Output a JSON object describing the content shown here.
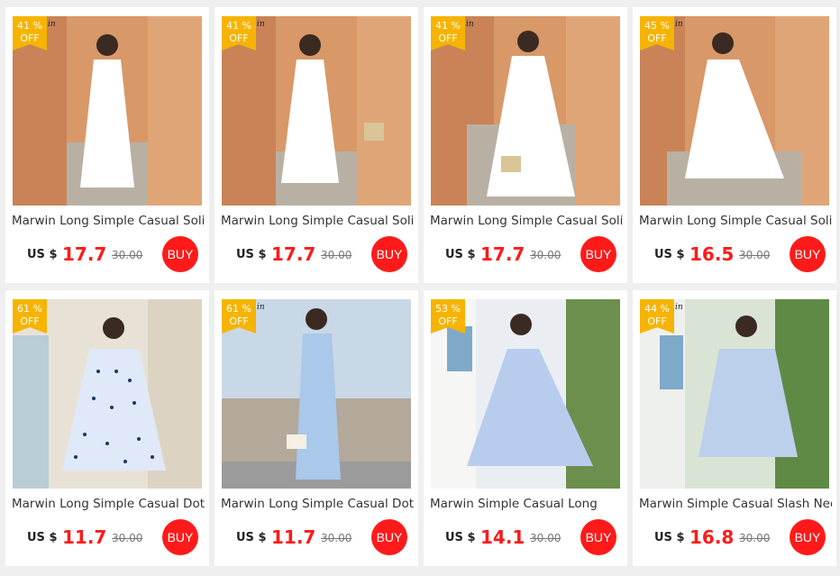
{
  "products": [
    {
      "discount": "41 %",
      "off": "OFF",
      "brand_fragment": "in",
      "title": "Marwin Long Simple Casual Solid",
      "currency": "US $",
      "price": "17.7",
      "old_price": "30.00",
      "buy": "BUY",
      "dress_color": "#ffffff",
      "bg_color": "#d89868"
    },
    {
      "discount": "41 %",
      "off": "OFF",
      "brand_fragment": "in",
      "title": "Marwin Long Simple Casual Solid",
      "currency": "US $",
      "price": "17.7",
      "old_price": "30.00",
      "buy": "BUY",
      "dress_color": "#ffffff",
      "bg_color": "#d89868"
    },
    {
      "discount": "41 %",
      "off": "OFF",
      "brand_fragment": "in",
      "title": "Marwin Long Simple Casual Solid",
      "currency": "US $",
      "price": "17.7",
      "old_price": "30.00",
      "buy": "BUY",
      "dress_color": "#ffffff",
      "bg_color": "#d89868"
    },
    {
      "discount": "45 %",
      "off": "OFF",
      "brand_fragment": "in",
      "title": "Marwin Long Simple Casual Solid",
      "currency": "US $",
      "price": "16.5",
      "old_price": "30.00",
      "buy": "BUY",
      "dress_color": "#ffffff",
      "bg_color": "#d89868"
    },
    {
      "discount": "61 %",
      "off": "OFF",
      "brand_fragment": "",
      "title": "Marwin Long Simple Casual Dot",
      "currency": "US $",
      "price": "11.7",
      "old_price": "30.00",
      "buy": "BUY",
      "dress_color": "#dfe9f7",
      "bg_color": "#e8e2d6"
    },
    {
      "discount": "61 %",
      "off": "OFF",
      "brand_fragment": "in",
      "title": "Marwin Long Simple Casual Dot",
      "currency": "US $",
      "price": "11.7",
      "old_price": "30.00",
      "buy": "BUY",
      "dress_color": "#a9c8ea",
      "bg_color": "#c9d8e6"
    },
    {
      "discount": "53 %",
      "off": "OFF",
      "brand_fragment": "",
      "title": "Marwin Simple Casual Long",
      "currency": "US $",
      "price": "14.1",
      "old_price": "30.00",
      "buy": "BUY",
      "dress_color": "#b8cdee",
      "bg_color": "#eaeef3"
    },
    {
      "discount": "44 %",
      "off": "OFF",
      "brand_fragment": "in",
      "title": "Marwin Simple Casual Slash Neck",
      "currency": "US $",
      "price": "16.8",
      "old_price": "30.00",
      "buy": "BUY",
      "dress_color": "#bcd0ec",
      "bg_color": "#d9e4d4"
    }
  ]
}
